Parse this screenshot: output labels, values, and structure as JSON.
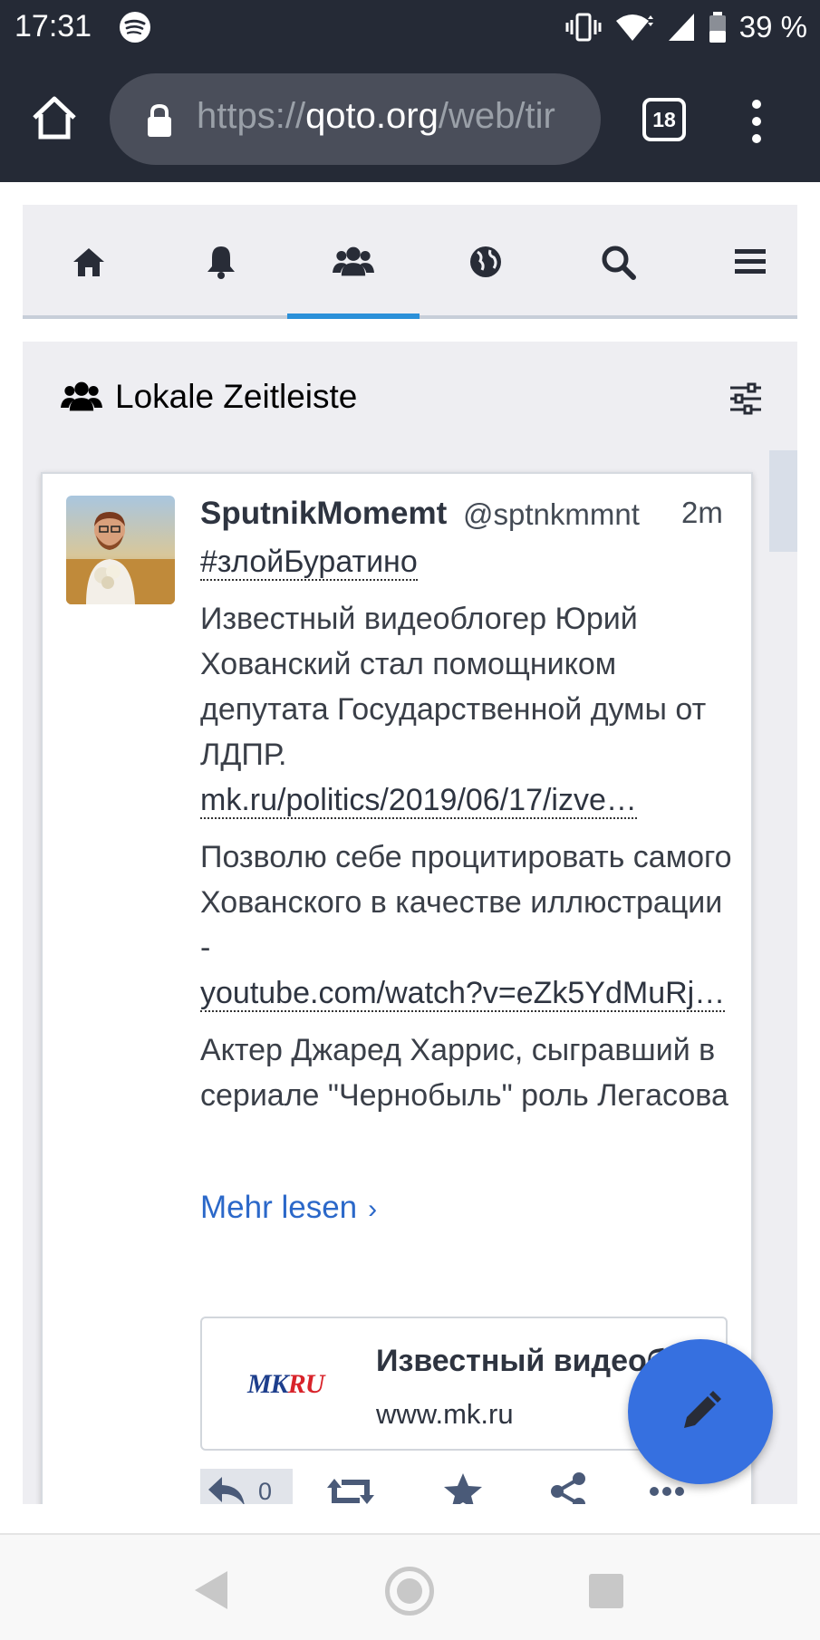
{
  "status_bar": {
    "time": "17:31",
    "battery": "39 %"
  },
  "browser": {
    "url_prefix": "https://",
    "url_host": "qoto.org",
    "url_path": "/web/tir",
    "tab_count": "18"
  },
  "nav_tabs": [
    "home-tab",
    "notifications-tab",
    "local-timeline-tab",
    "federated-timeline-tab",
    "search-tab",
    "menu-tab"
  ],
  "column": {
    "title": "Lokale Zeitleiste"
  },
  "status": {
    "display_name": "SputnikMomemt",
    "acct": "@sptnkmmnt",
    "time_ago": "2m",
    "hashtag": "#злойБуратино",
    "para1": "Известный видеоблогер Юрий Хованский стал помощником депутата Государственной думы от ЛДПР.",
    "link1": "mk.ru/politics/2019/06/17/izve…",
    "para2": "Позволю себе процитировать самого Хованского в качестве иллюстрации -",
    "link2": "youtube.com/watch?v=eZk5YdMuRj…",
    "para3": "Актер Джаред Харрис, сыгравший в сериале \"Чернобыль\" роль Легасова",
    "read_more": "Mehr lesen",
    "card": {
      "logo": "MKRU",
      "title": "Известный видеоб",
      "host": "www.mk.ru"
    },
    "reply_count": "0"
  },
  "colors": {
    "accent": "#2b90d9",
    "fab": "#3670e0",
    "link": "#2b68c9",
    "chrome_bg": "#252a36"
  }
}
